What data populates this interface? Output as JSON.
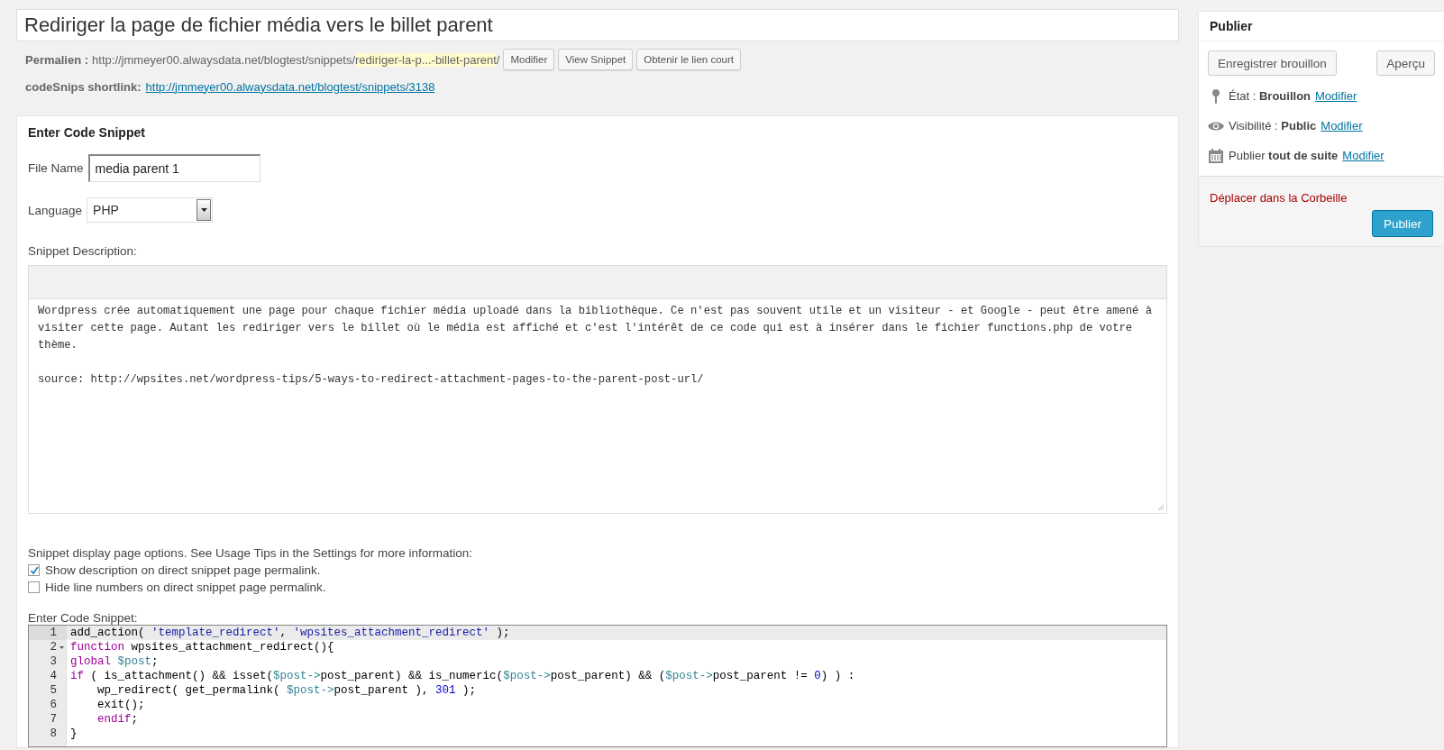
{
  "title_field": {
    "value": "Rediriger la page de fichier média vers le billet parent"
  },
  "permalink": {
    "label": "Permalien :",
    "base": "http://jmmeyer00.alwaysdata.net/blogtest/snippets/",
    "slug": "rediriger-la-p...-billet-parent",
    "trail": "/",
    "buttons": [
      "Modifier",
      "View Snippet",
      "Obtenir le lien court"
    ]
  },
  "shortlink": {
    "label": "codeSnips shortlink:",
    "url": "http://jmmeyer00.alwaysdata.net/blogtest/snippets/3138"
  },
  "snippet_box": {
    "title": "Enter Code Snippet",
    "file_name": {
      "label": "File Name",
      "value": "media parent 1"
    },
    "language": {
      "label": "Language",
      "value": "PHP"
    },
    "description": {
      "label": "Snippet Description:",
      "paragraphs": [
        "Wordpress crée automatiquement une page pour chaque fichier média uploadé dans la bibliothèque. Ce n'est pas souvent utile et un visiteur - et Google - peut être amené à visiter cette page. Autant les rediriger vers le billet où le média est affiché et c'est l'intérêt de ce code qui est à insérer dans le fichier functions.php de votre thème.",
        "source: http://wpsites.net/wordpress-tips/5-ways-to-redirect-attachment-pages-to-the-parent-post-url/"
      ]
    },
    "options_text": "Snippet display page options. See Usage Tips in the Settings for more information:",
    "options": [
      {
        "label": "Show description on direct snippet page permalink.",
        "checked": true
      },
      {
        "label": "Hide line numbers on direct snippet page permalink.",
        "checked": false
      }
    ],
    "code_label": "Enter Code Snippet:",
    "code_lines": [
      {
        "number": "1",
        "active": true,
        "foldable": false,
        "tokens": [
          {
            "kind": "plain",
            "text": "add_action( "
          },
          {
            "kind": "string",
            "text": "'template_redirect'"
          },
          {
            "kind": "plain",
            "text": ", "
          },
          {
            "kind": "string",
            "text": "'wpsites_attachment_redirect'"
          },
          {
            "kind": "plain",
            "text": " );"
          }
        ]
      },
      {
        "number": "2",
        "active": false,
        "foldable": true,
        "tokens": [
          {
            "kind": "keyword",
            "text": "function"
          },
          {
            "kind": "plain",
            "text": " wpsites_attachment_redirect(){"
          }
        ]
      },
      {
        "number": "3",
        "active": false,
        "foldable": false,
        "tokens": [
          {
            "kind": "keyword",
            "text": "global"
          },
          {
            "kind": "variable",
            "text": " $post"
          },
          {
            "kind": "plain",
            "text": ";"
          }
        ]
      },
      {
        "number": "4",
        "active": false,
        "foldable": false,
        "tokens": [
          {
            "kind": "keyword",
            "text": "if"
          },
          {
            "kind": "plain",
            "text": " ( is_attachment() && isset("
          },
          {
            "kind": "variable",
            "text": "$post->"
          },
          {
            "kind": "plain",
            "text": "post_parent) && is_numeric("
          },
          {
            "kind": "variable",
            "text": "$post->"
          },
          {
            "kind": "plain",
            "text": "post_parent) && ("
          },
          {
            "kind": "variable",
            "text": "$post->"
          },
          {
            "kind": "plain",
            "text": "post_parent != "
          },
          {
            "kind": "number",
            "text": "0"
          },
          {
            "kind": "plain",
            "text": ") ) :"
          }
        ]
      },
      {
        "number": "5",
        "active": false,
        "foldable": false,
        "tokens": [
          {
            "kind": "plain",
            "text": "    wp_redirect( get_permalink( "
          },
          {
            "kind": "variable",
            "text": "$post->"
          },
          {
            "kind": "plain",
            "text": "post_parent ), "
          },
          {
            "kind": "number",
            "text": "301"
          },
          {
            "kind": "plain",
            "text": " );"
          }
        ]
      },
      {
        "number": "6",
        "active": false,
        "foldable": false,
        "tokens": [
          {
            "kind": "plain",
            "text": "    exit();"
          }
        ]
      },
      {
        "number": "7",
        "active": false,
        "foldable": false,
        "tokens": [
          {
            "kind": "keyword",
            "text": "    endif"
          },
          {
            "kind": "plain",
            "text": ";"
          }
        ]
      },
      {
        "number": "8",
        "active": false,
        "foldable": false,
        "tokens": [
          {
            "kind": "plain",
            "text": "}"
          }
        ]
      }
    ]
  },
  "publish_box": {
    "title": "Publier",
    "buttons": [
      "Enregistrer brouillon",
      "Aperçu"
    ],
    "rows": [
      {
        "kind": "status",
        "label": "État : ",
        "value": "Brouillon",
        "link": "Modifier"
      },
      {
        "kind": "visibility",
        "label": "Visibilité : ",
        "value": "Public",
        "link": "Modifier"
      },
      {
        "kind": "schedule",
        "label": "Publier ",
        "value": "tout de suite",
        "link": "Modifier"
      }
    ],
    "trash_link": "Déplacer dans la Corbeille",
    "publish_button": "Publier"
  }
}
